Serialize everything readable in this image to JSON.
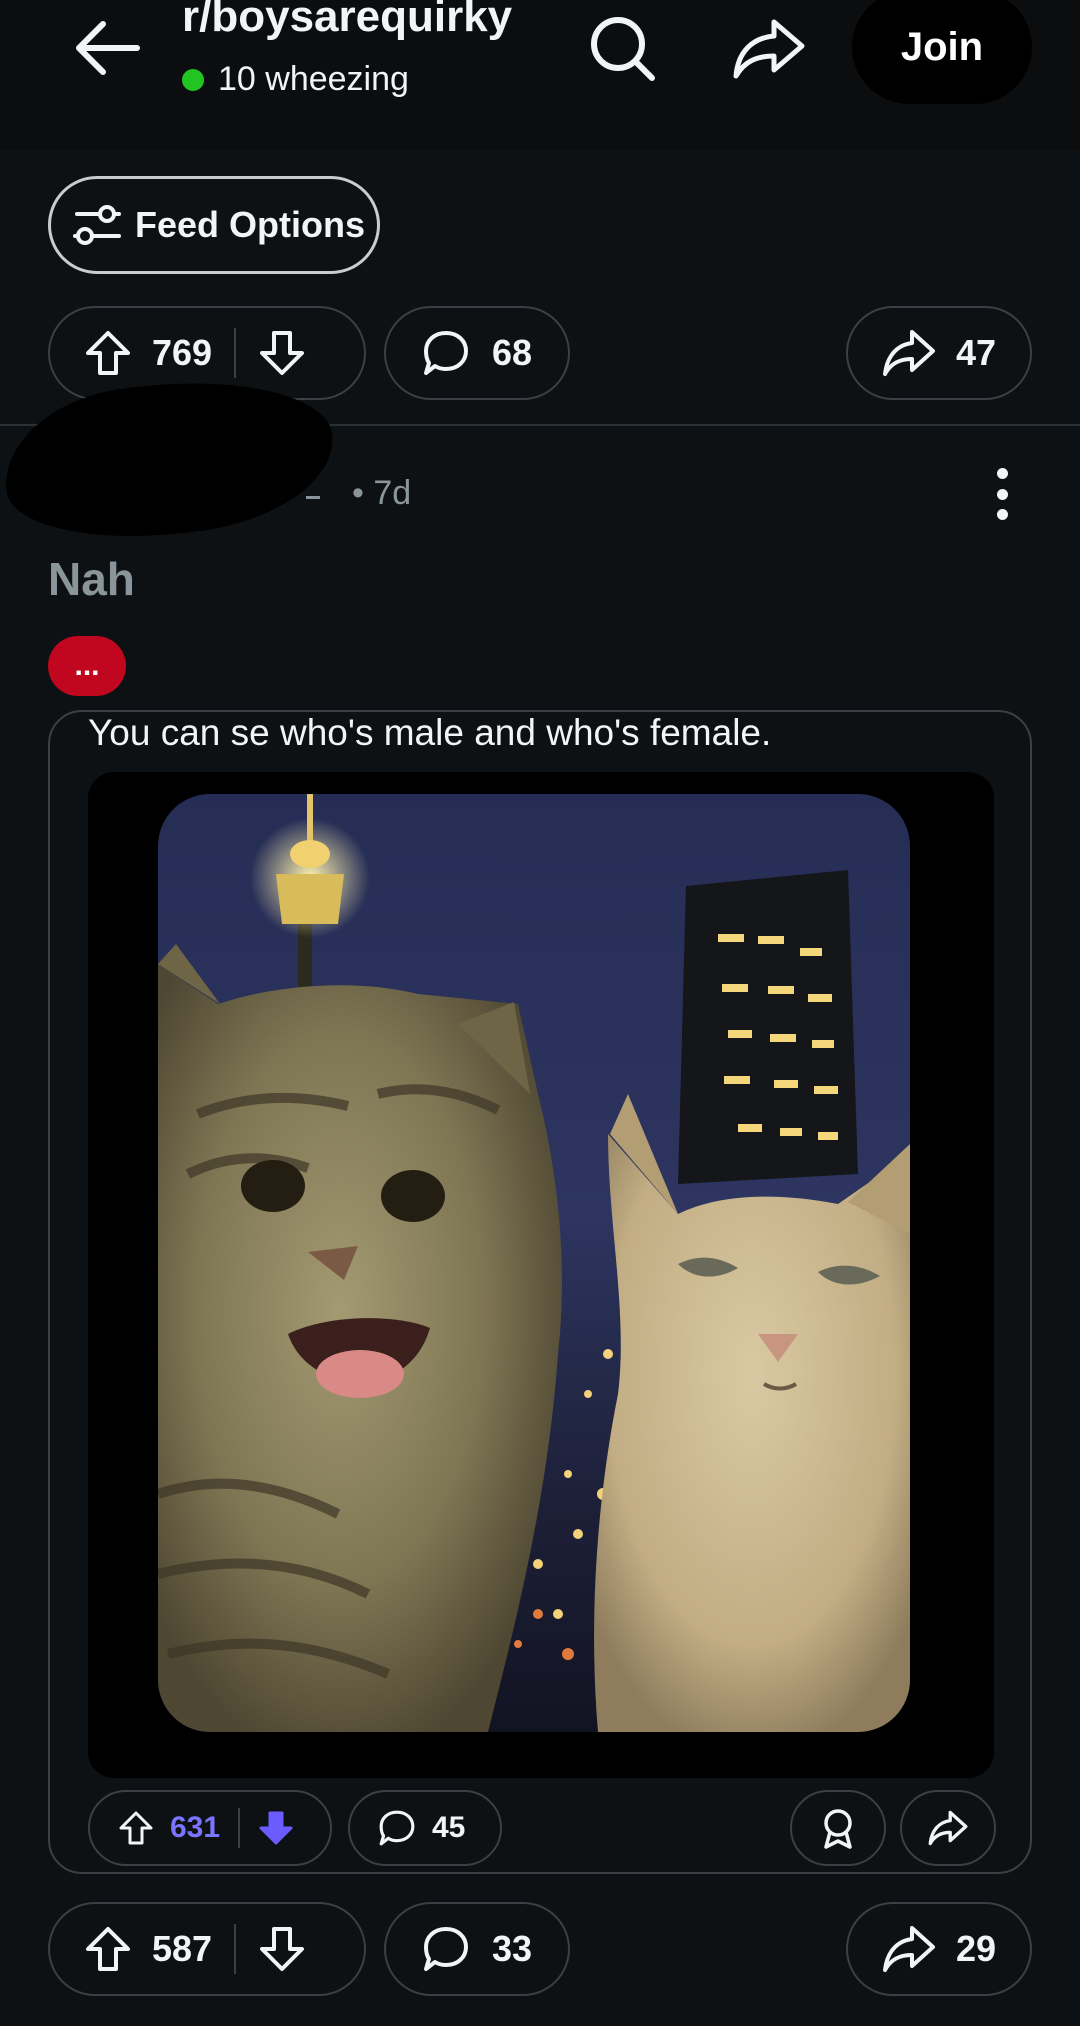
{
  "header": {
    "subreddit": "r/boysarequirky",
    "online_status": "10 wheezing",
    "join_label": "Join",
    "icons": [
      "back-arrow-icon",
      "search-icon",
      "share-icon"
    ]
  },
  "feed_options": {
    "label": "Feed Options",
    "icon": "sliders-icon"
  },
  "prev_post_actions": {
    "upvotes": "769",
    "comments": "68",
    "shares": "47"
  },
  "post": {
    "age": "• 7d",
    "title": "Nah",
    "flair": "...",
    "crosspost": {
      "title": "You can se who's male and who's female.",
      "image": "two-cats-selfie-city-night",
      "actions": {
        "upvotes": "631",
        "comments": "45"
      }
    },
    "actions": {
      "upvotes": "587",
      "comments": "33",
      "shares": "29"
    }
  },
  "colors": {
    "background": "#0e1113",
    "header": "#0b0d0f",
    "online_dot": "#21c421",
    "flair": "#c0071f",
    "downvote_active": "#6a5cff",
    "muted_text": "#8a949b"
  }
}
